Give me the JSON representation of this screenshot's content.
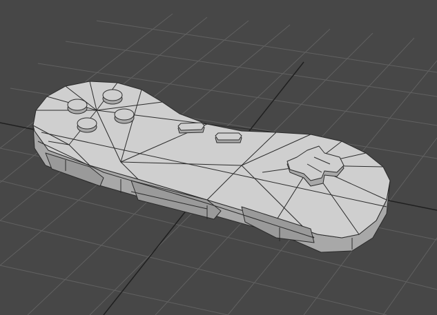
{
  "viewport": {
    "background": "#474747",
    "grid_color": "#616161",
    "grid_axis_color": "#1f1f1f",
    "mesh_fill": "#bfbfbf",
    "mesh_fill_top": "#cfcfcf",
    "mesh_fill_side": "#a8a8a8",
    "wire_color": "#2a2a2a"
  },
  "model": {
    "object": "game-controller-wireframe",
    "left_buttons": [
      "button-top",
      "button-left",
      "button-right",
      "button-bottom"
    ],
    "center_buttons": [
      "select-button",
      "start-button"
    ],
    "dpad": "dpad-cross"
  }
}
